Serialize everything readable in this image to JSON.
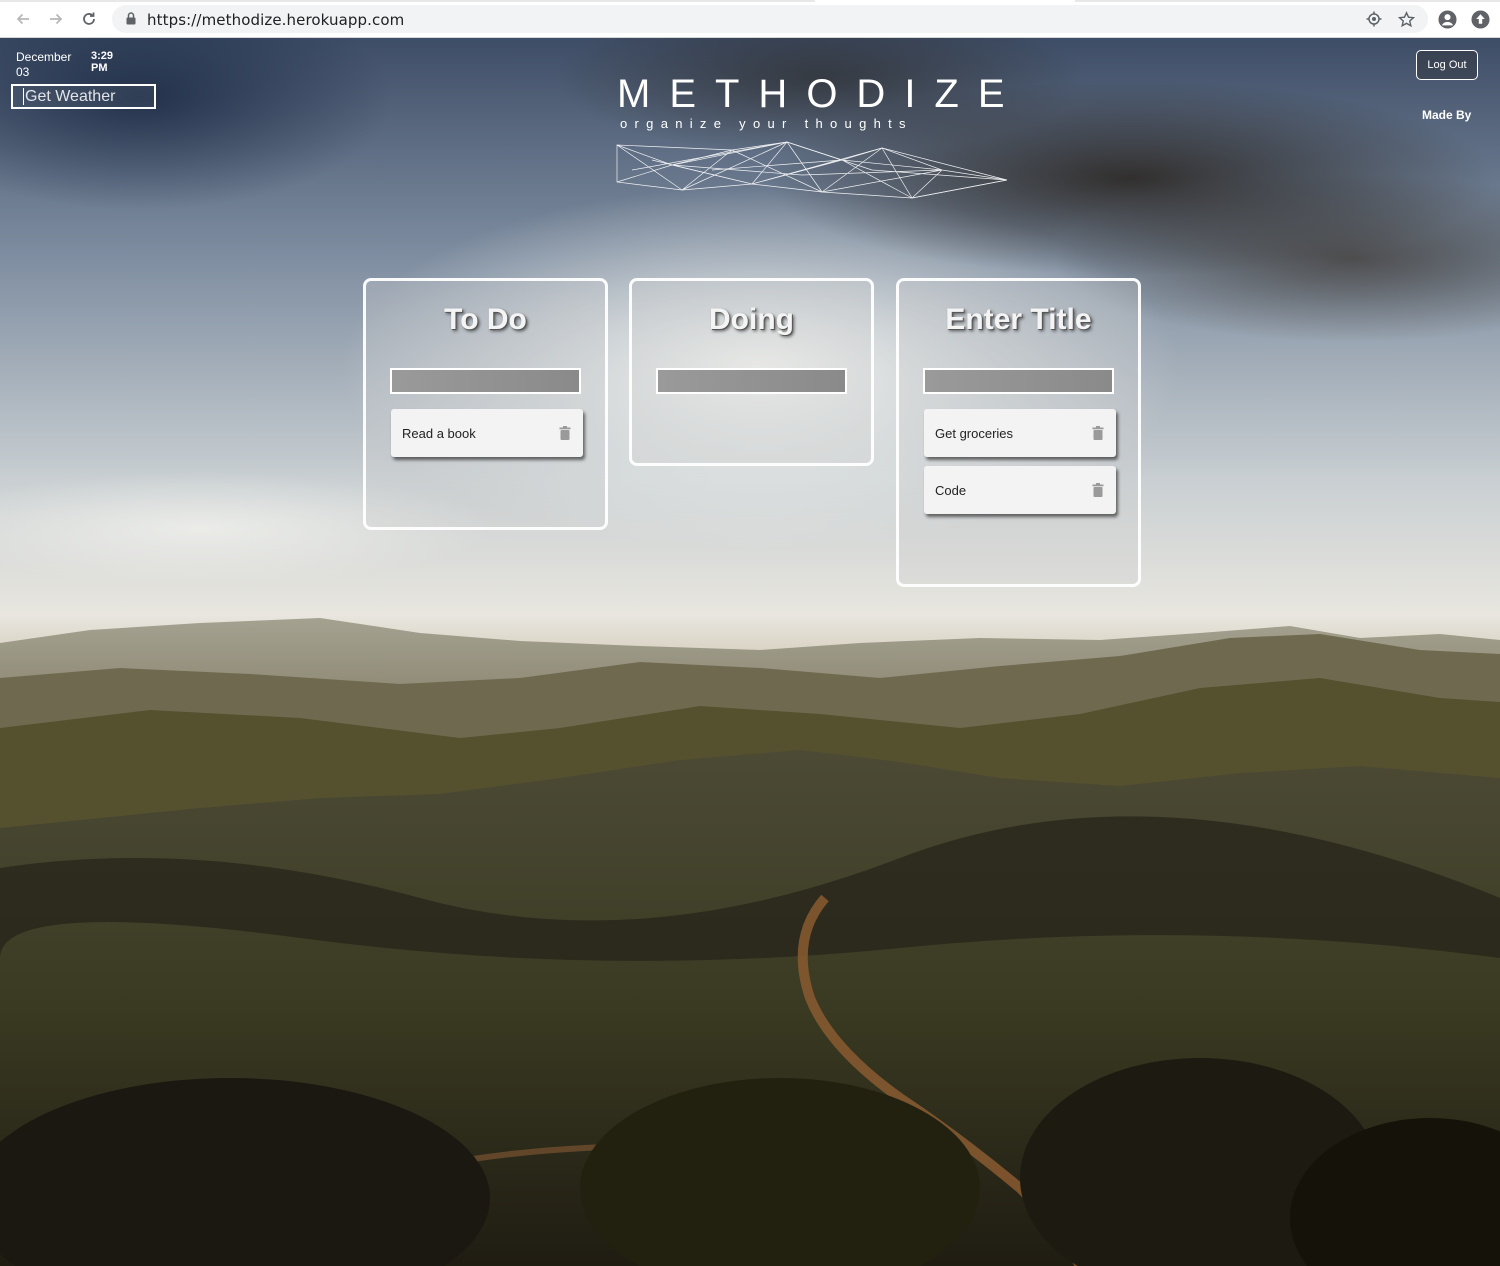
{
  "browser": {
    "url": "https://methodize.herokuapp.com",
    "icons": [
      "back-arrow-icon",
      "forward-arrow-icon",
      "reload-icon",
      "lock-icon",
      "location-icon",
      "star-icon",
      "account-icon",
      "extension-icon"
    ]
  },
  "header": {
    "date": "December 03",
    "time": "3:29 PM",
    "weather_placeholder": "Get Weather",
    "logout_label": "Log Out",
    "made_by_label": "Made By"
  },
  "brand": {
    "title": "METHODIZE",
    "subtitle": "organize your thoughts"
  },
  "columns": [
    {
      "title": "To Do",
      "cards": [
        "Read a book"
      ]
    },
    {
      "title": "Doing",
      "cards": []
    },
    {
      "title": "Enter Title",
      "cards": [
        "Get groceries",
        "Code"
      ]
    }
  ],
  "colors": {
    "column_border": "#ffffff",
    "card_bg": "#f3f3f3",
    "input_bg": "#939393"
  }
}
